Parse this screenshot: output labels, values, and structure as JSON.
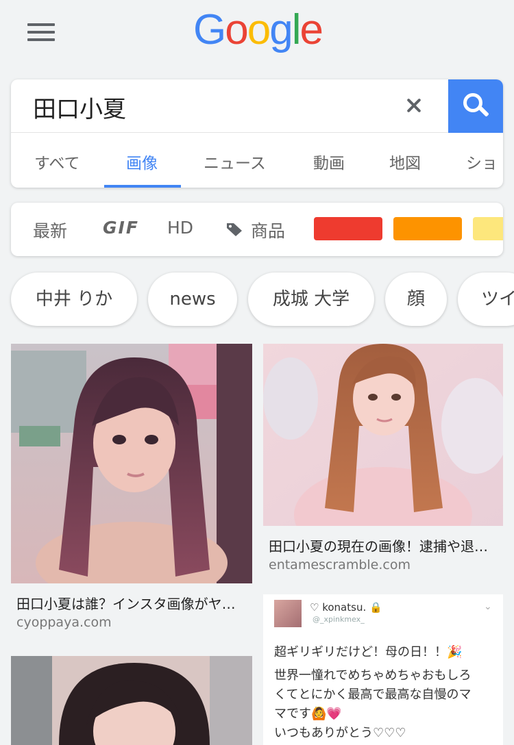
{
  "header": {
    "logo_letters": [
      "G",
      "o",
      "o",
      "g",
      "l",
      "e"
    ]
  },
  "search": {
    "query": "田口小夏"
  },
  "tabs": [
    {
      "label": "すべて"
    },
    {
      "label": "画像"
    },
    {
      "label": "ニュース"
    },
    {
      "label": "動画"
    },
    {
      "label": "地図"
    },
    {
      "label": "ショ"
    }
  ],
  "filters": {
    "latest": "最新",
    "gif": "GIF",
    "hd": "HD",
    "products": "商品",
    "color_swatches": [
      "#ee3b2f",
      "#fd9300",
      "#fde77c"
    ]
  },
  "chips": [
    {
      "label": "中井 りか"
    },
    {
      "label": "news"
    },
    {
      "label": "成城 大学"
    },
    {
      "label": "顔"
    },
    {
      "label": "ツイ"
    }
  ],
  "results": [
    {
      "caption": "田口小夏は誰？インスタ画像がヤ…",
      "source": "cyoppaya.com"
    },
    {
      "caption": "田口小夏の現在の画像！逮捕や退…",
      "source": "entamescramble.com"
    }
  ],
  "tweet": {
    "name": "♡ konatsu. 🔒",
    "id": "@_xpinkmex_",
    "lines": [
      "超ギリギリだけど！母の日！！🎉",
      "世界一憧れでめちゃめちゃおもしろ",
      "くてとにかく最高で最高な自慢のマ",
      "マです🙆💗",
      "いつもありがとう♡♡♡"
    ]
  }
}
